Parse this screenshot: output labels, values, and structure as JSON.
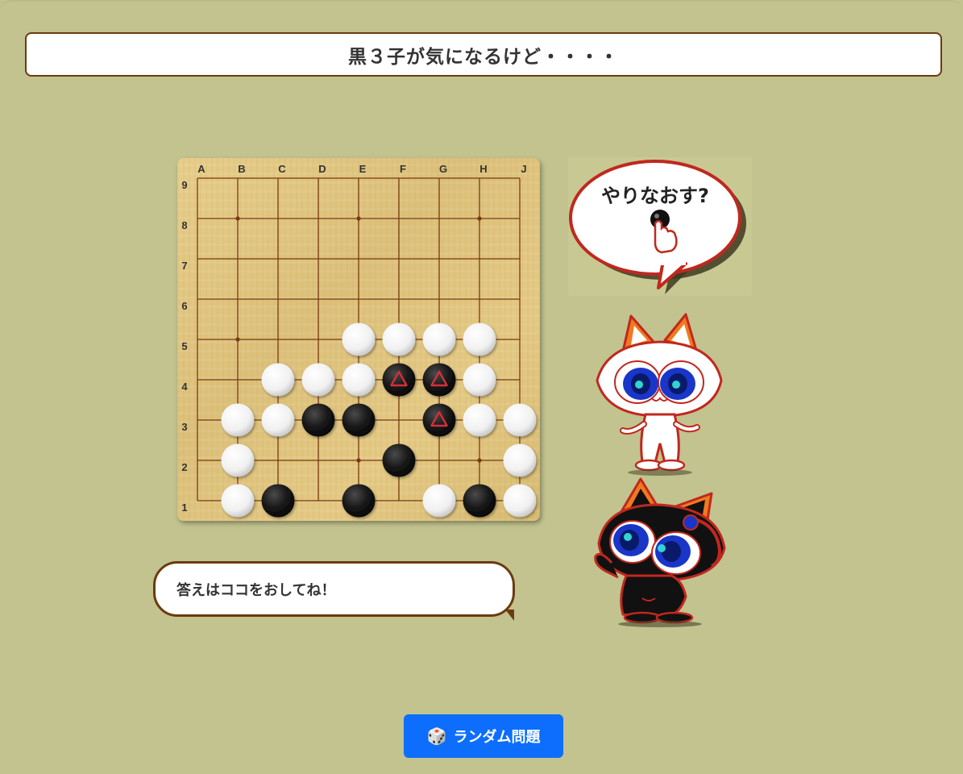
{
  "title": "黒３子が気になるけど・・・・",
  "board": {
    "size": 9,
    "col_labels": [
      "A",
      "B",
      "C",
      "D",
      "E",
      "F",
      "G",
      "H",
      "J"
    ],
    "row_labels": [
      "9",
      "8",
      "7",
      "6",
      "5",
      "4",
      "3",
      "2",
      "1"
    ],
    "hoshi": [
      "B8",
      "E8",
      "H8",
      "B5",
      "E2",
      "H2"
    ],
    "white_stones": [
      "E5",
      "F5",
      "G5",
      "H5",
      "C4",
      "D4",
      "E4",
      "H4",
      "B3",
      "C3",
      "H3",
      "J3",
      "B2",
      "J2",
      "B1",
      "G1",
      "J1"
    ],
    "black_stones": [
      "F4",
      "G4",
      "D3",
      "E3",
      "G3",
      "F2",
      "C1",
      "E1",
      "H1"
    ],
    "marked_triangles": [
      "F4",
      "G4",
      "G3"
    ],
    "colors": {
      "line": "#7a3a10",
      "mark": "#d2303a"
    }
  },
  "balloon": {
    "text": "やりなおす?"
  },
  "hint": {
    "text": "答えはココをおしてね！"
  },
  "random_button": {
    "icon": "dice-icon",
    "label": "ランダム問題"
  }
}
